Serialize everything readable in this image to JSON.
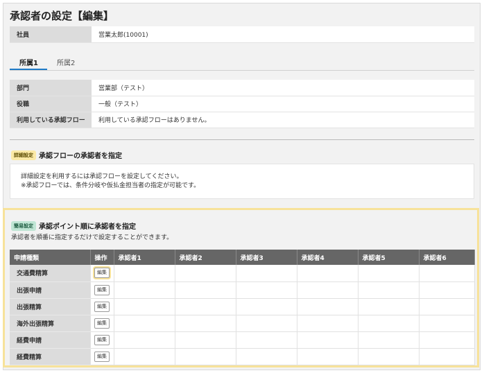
{
  "page": {
    "title": "承認者の設定【編集】"
  },
  "employee": {
    "label": "社員",
    "value": "営業太郎(10001)"
  },
  "tabs": [
    {
      "label": "所属1"
    },
    {
      "label": "所属2"
    }
  ],
  "details": [
    {
      "label": "部門",
      "value": "営業部（テスト）"
    },
    {
      "label": "役職",
      "value": "一般（テスト）"
    },
    {
      "label": "利用している承認フロー",
      "value": "利用している承認フローはありません。"
    }
  ],
  "detail_section": {
    "badge": "詳細設定",
    "title": "承認フローの承認者を指定",
    "notice_line1": "詳細設定を利用するには承認フローを設定してください。",
    "notice_line2": "※承認フローでは、条件分岐や仮払金担当者の指定が可能です。"
  },
  "simple_section": {
    "badge": "簡易設定",
    "title": "承認ポイント順に承認者を指定",
    "description": "承認者を順番に指定するだけで設定することができます。"
  },
  "grid": {
    "headers": [
      "申請種類",
      "操作",
      "承認者1",
      "承認者2",
      "承認者3",
      "承認者4",
      "承認者5",
      "承認者6"
    ],
    "edit_label": "編集",
    "rows": [
      "交通費精算",
      "出張申請",
      "出張精算",
      "海外出張精算",
      "経費申請",
      "経費精算"
    ]
  },
  "colors": {
    "tab_accent": "#1e7bc7",
    "highlight": "#f7e29a",
    "header_bg": "#666666"
  }
}
